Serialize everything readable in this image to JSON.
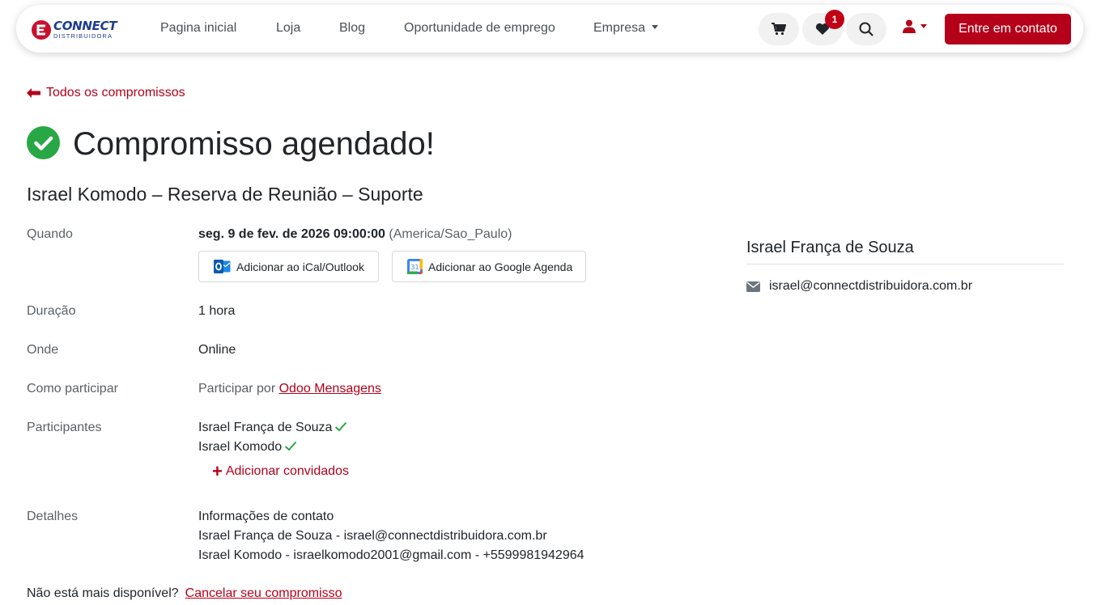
{
  "header": {
    "logo": {
      "line1": "CONNECT",
      "line2": "DISTRIBUIDORA"
    },
    "nav": [
      {
        "label": "Pagina inicial"
      },
      {
        "label": "Loja"
      },
      {
        "label": "Blog"
      },
      {
        "label": "Oportunidade de emprego"
      },
      {
        "label": "Empresa"
      }
    ],
    "wishlist_count": "1",
    "contact_button": "Entre em contato"
  },
  "back_link": "Todos os compromissos",
  "page_title": "Compromisso agendado!",
  "event_name": "Israel Komodo – Reserva de Reunião – Suporte",
  "details": {
    "when_label": "Quando",
    "when_value": "seg. 9 de fev. de 2026 09:00:00",
    "timezone": "(America/Sao_Paulo)",
    "ical_button": "Adicionar ao iCal/Outlook",
    "google_button": "Adicionar ao Google Agenda",
    "duration_label": "Duração",
    "duration_value": "1 hora",
    "where_label": "Onde",
    "where_value": "Online",
    "join_label": "Como participar",
    "join_prefix": "Participar por",
    "join_link": "Odoo Mensagens",
    "attendees_label": "Participantes",
    "attendees": [
      "Israel França de Souza",
      "Israel Komodo"
    ],
    "add_guests": "Adicionar convidados",
    "details_label": "Detalhes",
    "details_lines": [
      "Informações de contato",
      "Israel França de Souza - israel@connectdistribuidora.com.br",
      "Israel Komodo - israelkomodo2001@gmail.com - +5599981942964"
    ]
  },
  "organizer": {
    "name": "Israel França de Souza",
    "email": "israel@connectdistribuidora.com.br"
  },
  "cancel": {
    "question": "Não está mais disponível?",
    "link": "Cancelar seu compromisso"
  },
  "colors": {
    "brand_red": "#b5001a",
    "brand_blue": "#1d3c8f",
    "success_green": "#28a745"
  }
}
